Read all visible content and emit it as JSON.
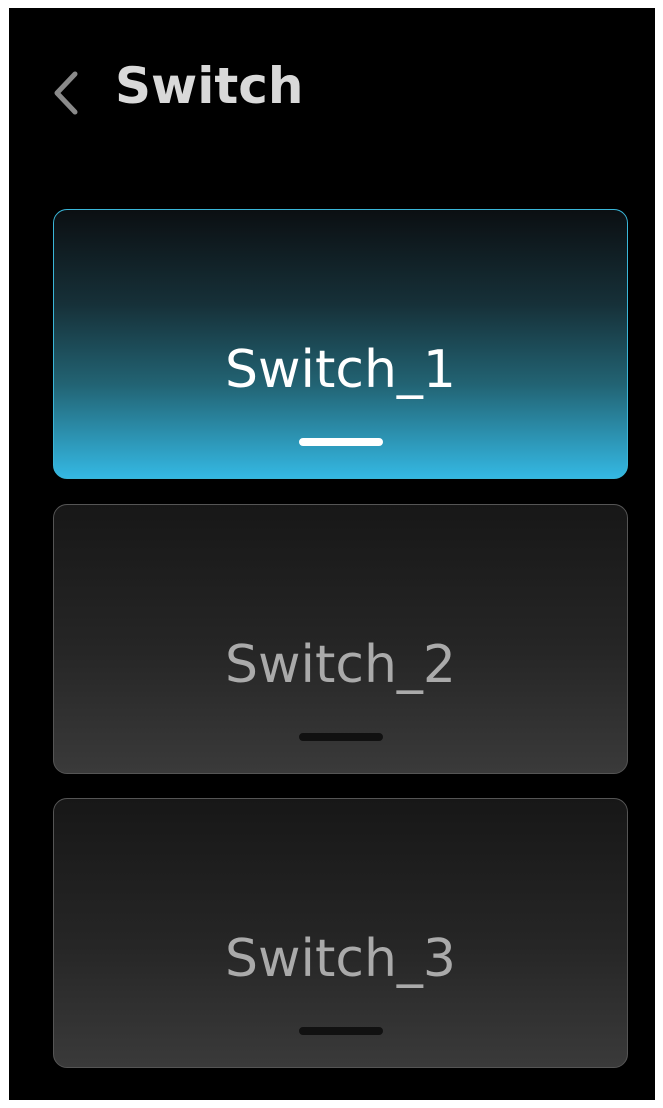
{
  "header": {
    "title": "Switch",
    "back_icon": "chevron-left-icon"
  },
  "switches": [
    {
      "label": "Switch_1",
      "state": "active"
    },
    {
      "label": "Switch_2",
      "state": "inactive"
    },
    {
      "label": "Switch_3",
      "state": "inactive"
    }
  ],
  "colors": {
    "background": "#000000",
    "active_accent": "#34b8e3",
    "active_text": "#ffffff",
    "inactive_text": "#aaaaaa",
    "title_text": "#d9d9d9"
  }
}
